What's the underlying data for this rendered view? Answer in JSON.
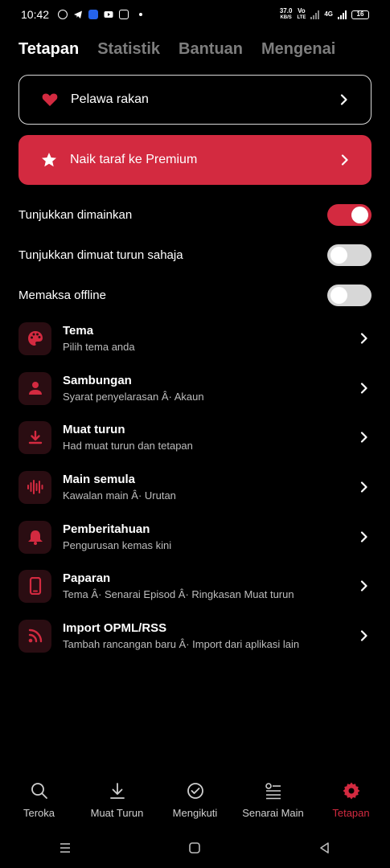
{
  "statusbar": {
    "time": "10:42",
    "net_speed": "37.0",
    "net_unit": "KB/S",
    "volte_top": "Vo",
    "volte_bottom": "LTE",
    "network": "4G",
    "battery": "16"
  },
  "tabs": [
    {
      "label": "Tetapan",
      "active": true
    },
    {
      "label": "Statistik",
      "active": false
    },
    {
      "label": "Bantuan",
      "active": false
    },
    {
      "label": "Mengenai",
      "active": false
    }
  ],
  "partner": {
    "label": "Pelawa rakan",
    "icon": "heart-icon"
  },
  "premium": {
    "label": "Naik taraf ke Premium",
    "icon": "star-icon"
  },
  "toggles": [
    {
      "label": "Tunjukkan dimainkan",
      "on": true
    },
    {
      "label": "Tunjukkan dimuat turun sahaja",
      "on": false
    },
    {
      "label": "Memaksa offline",
      "on": false
    }
  ],
  "items": [
    {
      "title": "Tema",
      "subtitle": "Pilih tema anda",
      "icon": "palette-icon"
    },
    {
      "title": "Sambungan",
      "subtitle": "Syarat penyelarasan Â· Akaun",
      "icon": "person-icon"
    },
    {
      "title": "Muat turun",
      "subtitle": "Had muat turun dan tetapan",
      "icon": "download-icon"
    },
    {
      "title": "Main semula",
      "subtitle": "Kawalan main Â· Urutan",
      "icon": "waveform-icon"
    },
    {
      "title": "Pemberitahuan",
      "subtitle": "Pengurusan kemas kini",
      "icon": "bell-icon"
    },
    {
      "title": "Paparan",
      "subtitle": "Tema Â· Senarai Episod Â· Ringkasan Muat turun",
      "icon": "phone-icon"
    },
    {
      "title": "Import OPML/RSS",
      "subtitle": "Tambah rancangan baru Â· Import dari aplikasi lain",
      "icon": "rss-icon"
    }
  ],
  "bottom_nav": [
    {
      "label": "Teroka",
      "icon": "search-icon",
      "active": false
    },
    {
      "label": "Muat Turun",
      "icon": "download-icon",
      "active": false
    },
    {
      "label": "Mengikuti",
      "icon": "check-circle-icon",
      "active": false
    },
    {
      "label": "Senarai Main",
      "icon": "playlist-icon",
      "active": false
    },
    {
      "label": "Tetapan",
      "icon": "gear-icon",
      "active": true
    }
  ],
  "colors": {
    "accent": "#d32a40",
    "background": "#000000",
    "tile": "#2a0d12"
  }
}
